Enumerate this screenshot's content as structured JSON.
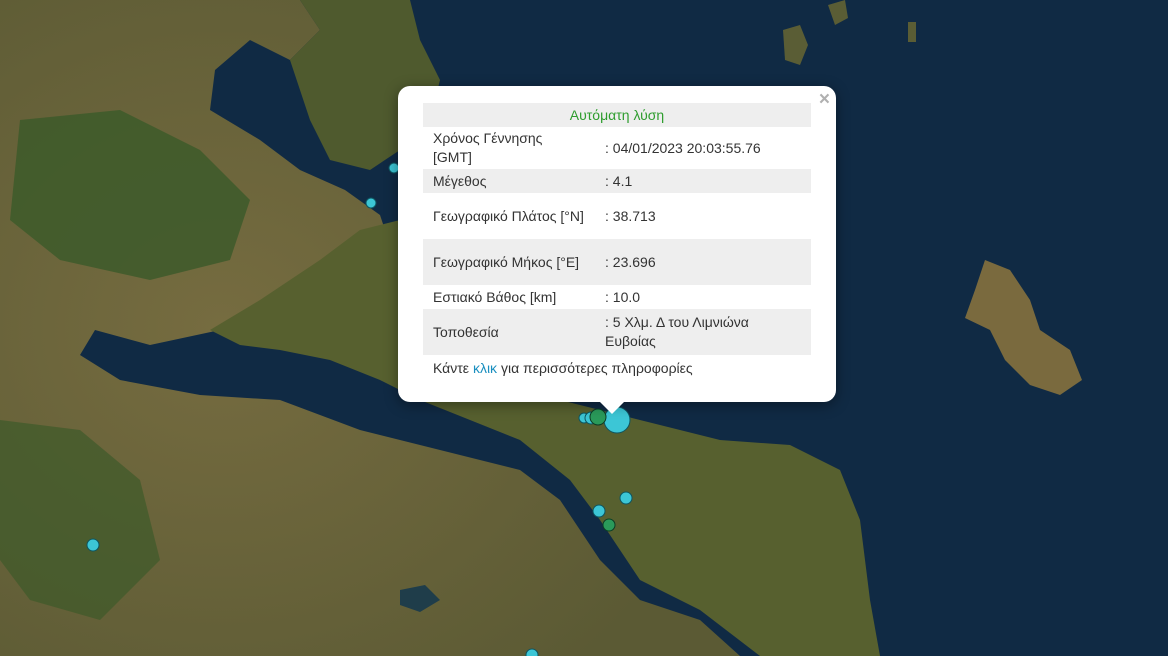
{
  "popup": {
    "title": "Αυτόματη λύση",
    "close_label": "×",
    "rows": [
      {
        "label": "Χρόνος Γέννησης [GMT]",
        "value": ": 04/01/2023 20:03:55.76"
      },
      {
        "label": "Μέγεθος",
        "value": ": 4.1"
      },
      {
        "label": "Γεωγραφικό Πλάτος [°N]",
        "value": ": 38.713"
      },
      {
        "label": "Γεωγραφικό Μήκος [°E]",
        "value": ": 23.696"
      },
      {
        "label": "Εστιακό Βάθος [km]",
        "value": ": 10.0"
      },
      {
        "label": "Τοποθεσία",
        "value": ": 5 Χλμ. Δ του Λιμνιώνα Ευβοίας"
      }
    ],
    "more_prefix": "Κάντε",
    "more_link": "κλικ",
    "more_suffix": "για περισσότερες πληροφορίες"
  },
  "colors": {
    "sea": "#102a44",
    "land": "#6f6a3e",
    "forest": "#3d5a2a",
    "marker_cyan": "#3cc6d6",
    "marker_green": "#2a9a5a",
    "title_green": "#2e9d2e",
    "link_blue": "#1a8fbf"
  }
}
